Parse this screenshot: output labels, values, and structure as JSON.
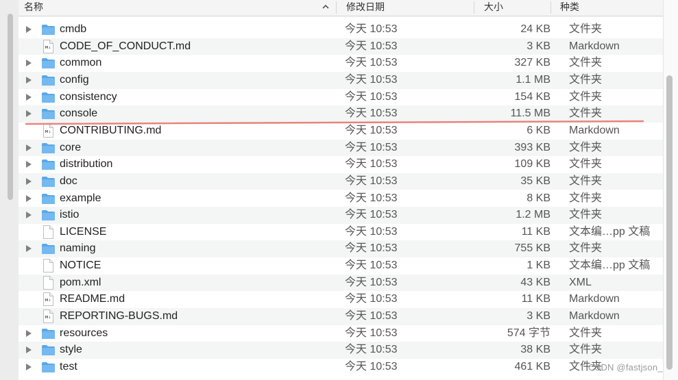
{
  "header": {
    "name_label": "名称",
    "date_label": "修改日期",
    "size_label": "大小",
    "kind_label": "种类",
    "sort_indicator": "chevron-up-icon"
  },
  "rows": [
    {
      "name": "cmdb",
      "date": "今天 10:53",
      "size": "24 KB",
      "kind": "文件夹",
      "icon": "folder-icon",
      "expandable": true
    },
    {
      "name": "CODE_OF_CONDUCT.md",
      "date": "今天 10:53",
      "size": "3 KB",
      "kind": "Markdown",
      "icon": "markdown-file-icon",
      "expandable": false
    },
    {
      "name": "common",
      "date": "今天 10:53",
      "size": "327 KB",
      "kind": "文件夹",
      "icon": "folder-icon",
      "expandable": true
    },
    {
      "name": "config",
      "date": "今天 10:53",
      "size": "1.1 MB",
      "kind": "文件夹",
      "icon": "folder-icon",
      "expandable": true
    },
    {
      "name": "consistency",
      "date": "今天 10:53",
      "size": "154 KB",
      "kind": "文件夹",
      "icon": "folder-icon",
      "expandable": true
    },
    {
      "name": "console",
      "date": "今天 10:53",
      "size": "11.5 MB",
      "kind": "文件夹",
      "icon": "folder-icon",
      "expandable": true
    },
    {
      "name": "CONTRIBUTING.md",
      "date": "今天 10:53",
      "size": "6 KB",
      "kind": "Markdown",
      "icon": "markdown-file-icon",
      "expandable": false
    },
    {
      "name": "core",
      "date": "今天 10:53",
      "size": "393 KB",
      "kind": "文件夹",
      "icon": "folder-icon",
      "expandable": true
    },
    {
      "name": "distribution",
      "date": "今天 10:53",
      "size": "109 KB",
      "kind": "文件夹",
      "icon": "folder-icon",
      "expandable": true
    },
    {
      "name": "doc",
      "date": "今天 10:53",
      "size": "35 KB",
      "kind": "文件夹",
      "icon": "folder-icon",
      "expandable": true
    },
    {
      "name": "example",
      "date": "今天 10:53",
      "size": "8 KB",
      "kind": "文件夹",
      "icon": "folder-icon",
      "expandable": true
    },
    {
      "name": "istio",
      "date": "今天 10:53",
      "size": "1.2 MB",
      "kind": "文件夹",
      "icon": "folder-icon",
      "expandable": true
    },
    {
      "name": "LICENSE",
      "date": "今天 10:53",
      "size": "11 KB",
      "kind": "文本编…pp 文稿",
      "icon": "text-file-icon",
      "expandable": false
    },
    {
      "name": "naming",
      "date": "今天 10:53",
      "size": "755 KB",
      "kind": "文件夹",
      "icon": "folder-icon",
      "expandable": true
    },
    {
      "name": "NOTICE",
      "date": "今天 10:53",
      "size": "1 KB",
      "kind": "文本编…pp 文稿",
      "icon": "text-file-icon",
      "expandable": false
    },
    {
      "name": "pom.xml",
      "date": "今天 10:53",
      "size": "43 KB",
      "kind": "XML",
      "icon": "text-file-icon",
      "expandable": false
    },
    {
      "name": "README.md",
      "date": "今天 10:53",
      "size": "11 KB",
      "kind": "Markdown",
      "icon": "markdown-file-icon",
      "expandable": false
    },
    {
      "name": "REPORTING-BUGS.md",
      "date": "今天 10:53",
      "size": "3 KB",
      "kind": "Markdown",
      "icon": "markdown-file-icon",
      "expandable": false
    },
    {
      "name": "resources",
      "date": "今天 10:53",
      "size": "574 字节",
      "kind": "文件夹",
      "icon": "folder-icon",
      "expandable": true
    },
    {
      "name": "style",
      "date": "今天 10:53",
      "size": "38 KB",
      "kind": "文件夹",
      "icon": "folder-icon",
      "expandable": true
    },
    {
      "name": "test",
      "date": "今天 10:53",
      "size": "461 KB",
      "kind": "文件夹",
      "icon": "folder-icon",
      "expandable": true
    }
  ],
  "watermark": "CSDN @fastjson_",
  "colors": {
    "folder": "#74b9ef",
    "annotation_line": "#e8837d",
    "alt_row": "#f4f5f5"
  }
}
